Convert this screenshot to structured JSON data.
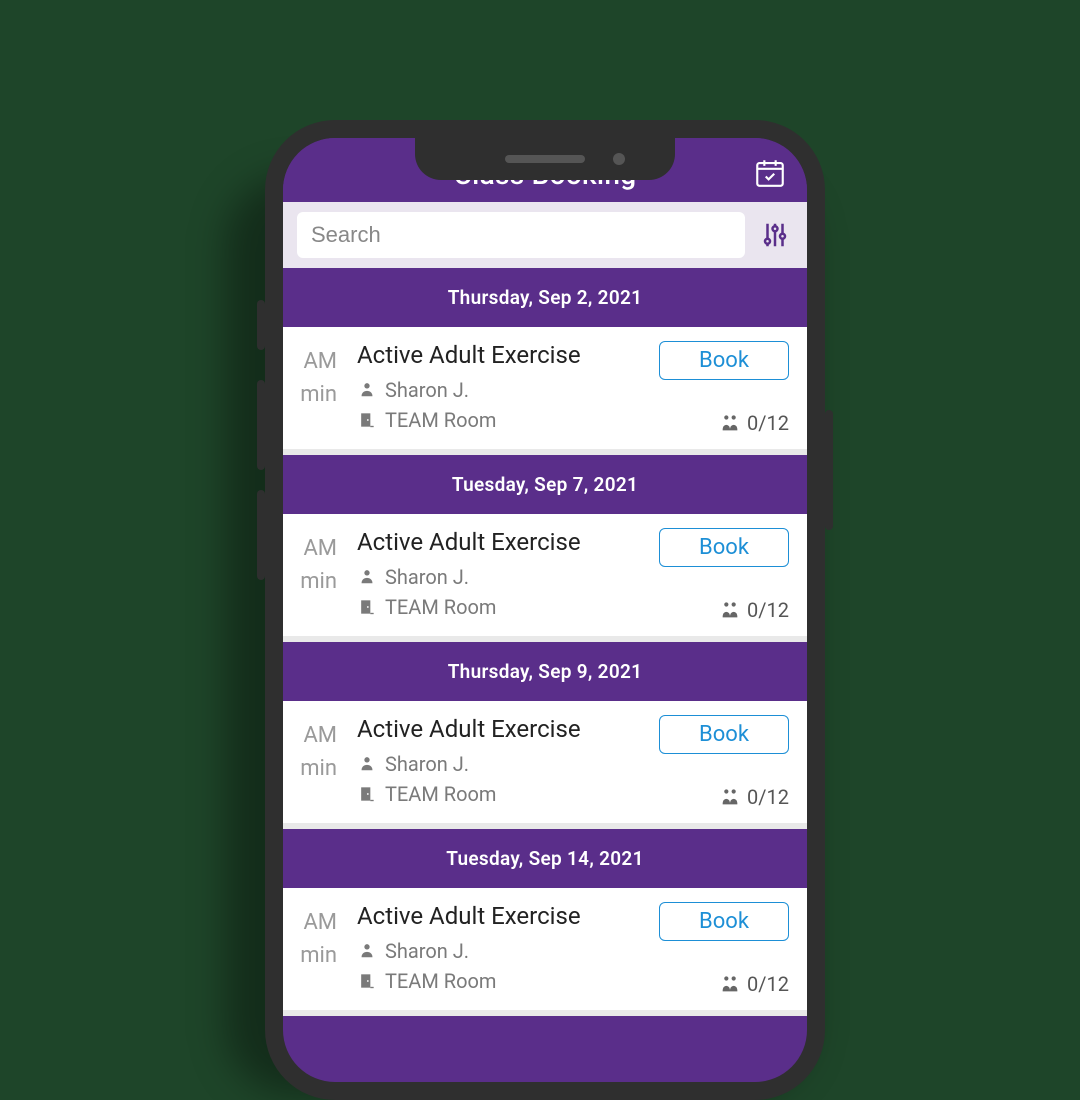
{
  "header": {
    "title": "Class Booking",
    "calendar_icon": "calendar-check-icon"
  },
  "search": {
    "placeholder": "Search",
    "value": "",
    "filter_icon": "sliders-icon"
  },
  "colors": {
    "brand": "#5a2e8a",
    "accent": "#1d8fd6",
    "bg": "#1e4529"
  },
  "sessions": [
    {
      "date_label": "Thursday, Sep 2, 2021",
      "time_ampm": "AM",
      "duration_suffix": "min",
      "class_name": "Active Adult Exercise",
      "instructor": "Sharon J.",
      "room": "TEAM Room",
      "book_label": "Book",
      "capacity": "0/12"
    },
    {
      "date_label": "Tuesday, Sep 7, 2021",
      "time_ampm": "AM",
      "duration_suffix": "min",
      "class_name": "Active Adult Exercise",
      "instructor": "Sharon J.",
      "room": "TEAM Room",
      "book_label": "Book",
      "capacity": "0/12"
    },
    {
      "date_label": "Thursday, Sep 9, 2021",
      "time_ampm": "AM",
      "duration_suffix": "min",
      "class_name": "Active Adult Exercise",
      "instructor": "Sharon J.",
      "room": "TEAM Room",
      "book_label": "Book",
      "capacity": "0/12"
    },
    {
      "date_label": "Tuesday, Sep 14, 2021",
      "time_ampm": "AM",
      "duration_suffix": "min",
      "class_name": "Active Adult Exercise",
      "instructor": "Sharon J.",
      "room": "TEAM Room",
      "book_label": "Book",
      "capacity": "0/12"
    }
  ]
}
